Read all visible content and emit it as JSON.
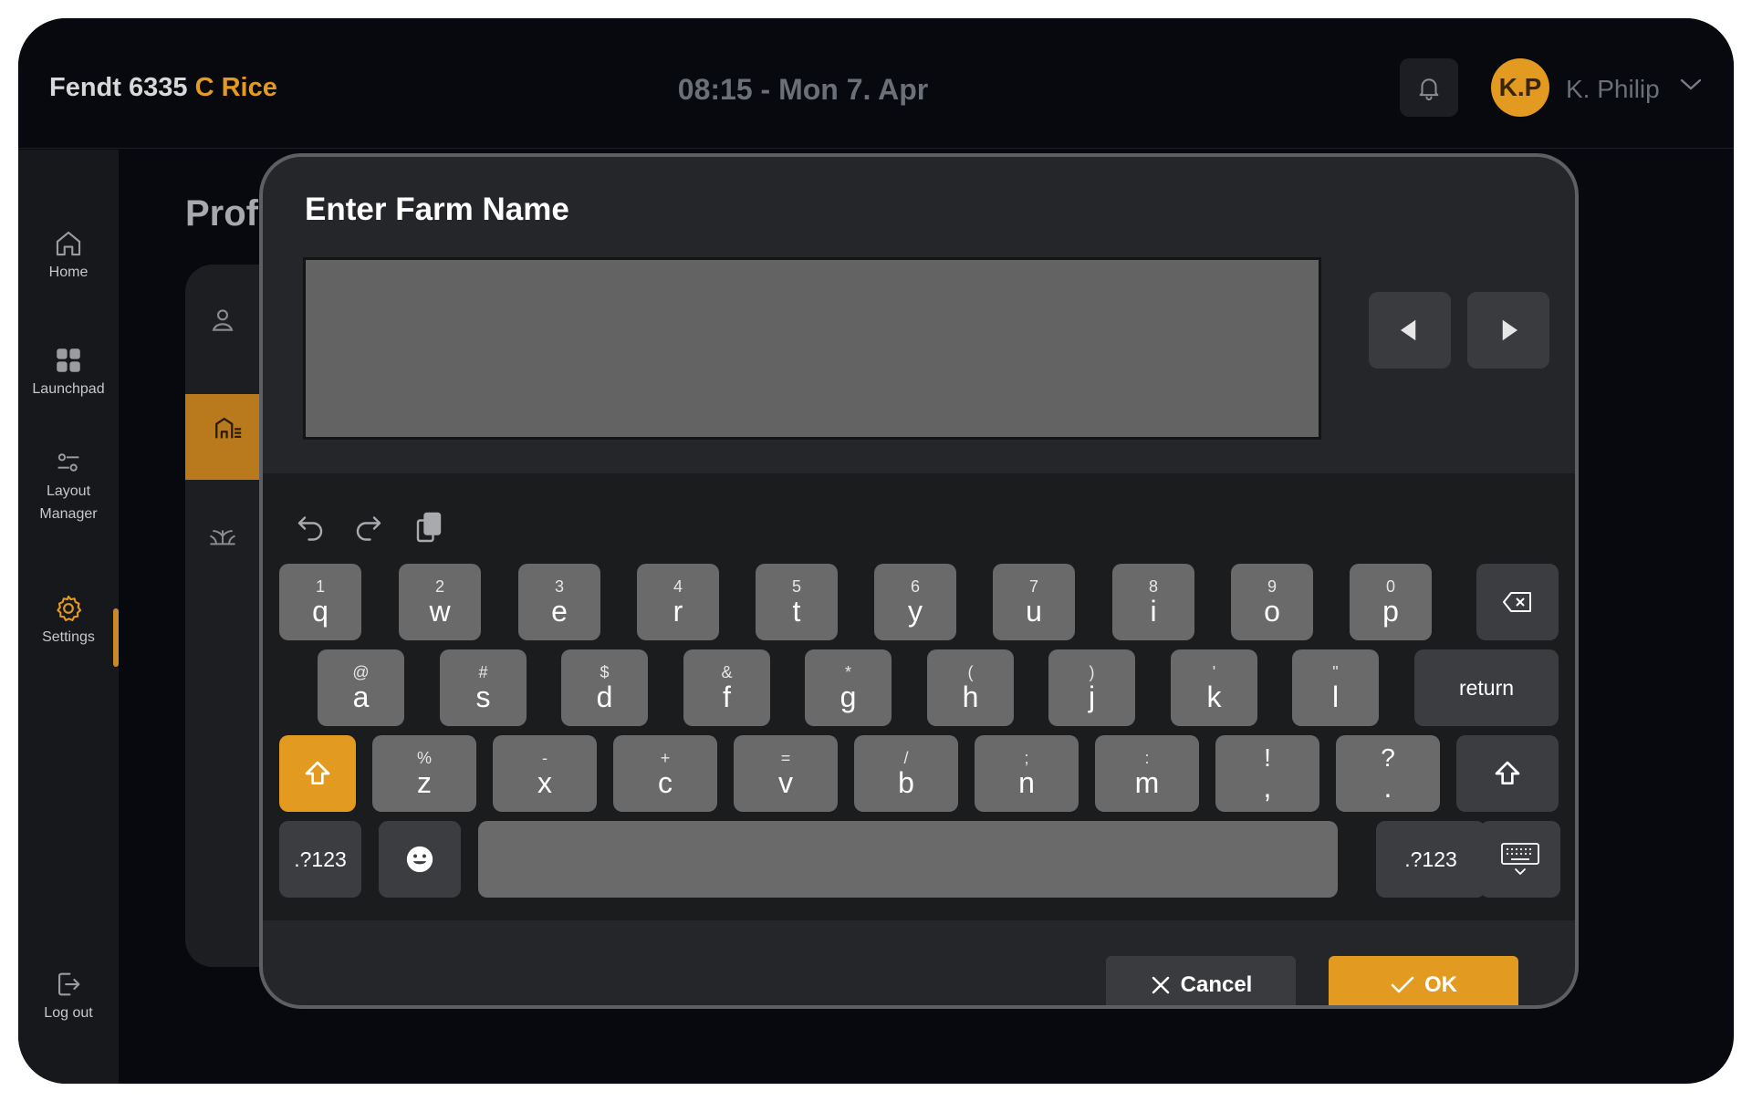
{
  "header": {
    "brand_main": "Fendt 6335",
    "brand_accent": "C Rice",
    "datetime": "08:15 - Mon 7. Apr",
    "avatar_initials": "K.P",
    "username": "K. Philip",
    "notification_icon": "bell-icon"
  },
  "sidebar": {
    "items": [
      {
        "label": "Home",
        "icon": "home-icon"
      },
      {
        "label": "Launchpad",
        "icon": "grid-icon"
      },
      {
        "label": "Layout Manager",
        "icon": "sliders-icon"
      },
      {
        "label": "Settings",
        "icon": "gear-icon"
      },
      {
        "label": "Log out",
        "icon": "logout-icon"
      }
    ],
    "active": "Settings"
  },
  "background_page": {
    "title_partial": "Prof"
  },
  "dialog": {
    "title": "Enter Farm Name",
    "input_value": "",
    "cancel_label": "Cancel",
    "ok_label": "OK"
  },
  "keyboard": {
    "row1": [
      {
        "sec": "1",
        "key": "q"
      },
      {
        "sec": "2",
        "key": "w"
      },
      {
        "sec": "3",
        "key": "e"
      },
      {
        "sec": "4",
        "key": "r"
      },
      {
        "sec": "5",
        "key": "t"
      },
      {
        "sec": "6",
        "key": "y"
      },
      {
        "sec": "7",
        "key": "u"
      },
      {
        "sec": "8",
        "key": "i"
      },
      {
        "sec": "9",
        "key": "o"
      },
      {
        "sec": "0",
        "key": "p"
      }
    ],
    "row2": [
      {
        "sec": "@",
        "key": "a"
      },
      {
        "sec": "#",
        "key": "s"
      },
      {
        "sec": "$",
        "key": "d"
      },
      {
        "sec": "&",
        "key": "f"
      },
      {
        "sec": "*",
        "key": "g"
      },
      {
        "sec": "(",
        "key": "h"
      },
      {
        "sec": ")",
        "key": "j"
      },
      {
        "sec": "'",
        "key": "k"
      },
      {
        "sec": "\"",
        "key": "l"
      }
    ],
    "row3": [
      {
        "sec": "%",
        "key": "z"
      },
      {
        "sec": "-",
        "key": "x"
      },
      {
        "sec": "+",
        "key": "c"
      },
      {
        "sec": "=",
        "key": "v"
      },
      {
        "sec": "/",
        "key": "b"
      },
      {
        "sec": ";",
        "key": "n"
      },
      {
        "sec": ":",
        "key": "m"
      },
      {
        "sec": "!",
        "key": ","
      },
      {
        "sec": "?",
        "key": "."
      }
    ],
    "return_label": "return",
    "symbols_label": ".?123",
    "accent_color": "#e39a20"
  }
}
